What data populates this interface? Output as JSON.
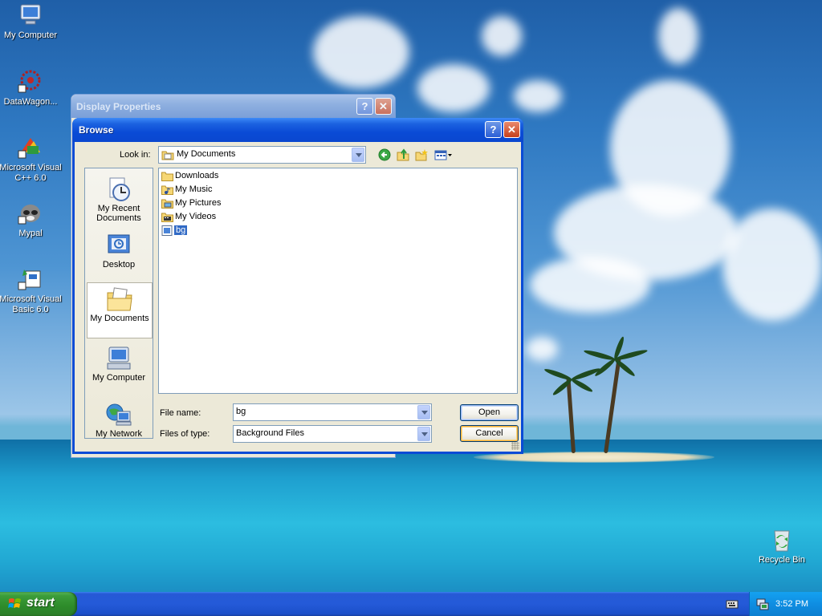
{
  "desktop": {
    "icons": [
      {
        "label": "My Computer",
        "icon": "my-computer-icon"
      },
      {
        "label": "DataWagon...",
        "icon": "datawagon-icon"
      },
      {
        "label": "Microsoft Visual C++ 6.0",
        "icon": "visual-cpp-icon"
      },
      {
        "label": "Mypal",
        "icon": "mypal-icon"
      },
      {
        "label": "Microsoft Visual Basic 6.0",
        "icon": "visual-basic-icon"
      }
    ],
    "recycle_bin": {
      "label": "Recycle Bin",
      "icon": "recycle-bin-icon"
    }
  },
  "display_properties": {
    "title": "Display Properties",
    "help_label": "?",
    "close_label": "✕"
  },
  "browse": {
    "title": "Browse",
    "help_label": "?",
    "close_label": "✕",
    "look_in_label": "Look in:",
    "look_in_value": "My Documents",
    "toolbar_icons": [
      "back-icon",
      "up-folder-icon",
      "new-folder-icon",
      "views-menu-icon"
    ],
    "places": [
      {
        "label": "My Recent Documents",
        "icon": "recent-documents-icon",
        "selected": false
      },
      {
        "label": "Desktop",
        "icon": "desktop-icon",
        "selected": false
      },
      {
        "label": "My Documents",
        "icon": "my-documents-icon",
        "selected": true
      },
      {
        "label": "My Computer",
        "icon": "my-computer-icon",
        "selected": false
      },
      {
        "label": "My Network",
        "icon": "my-network-icon",
        "selected": false
      }
    ],
    "files": [
      {
        "name": "Downloads",
        "icon": "folder-icon",
        "selected": false
      },
      {
        "name": "My Music",
        "icon": "music-folder-icon",
        "selected": false
      },
      {
        "name": "My Pictures",
        "icon": "pictures-folder-icon",
        "selected": false
      },
      {
        "name": "My Videos",
        "icon": "videos-folder-icon",
        "selected": false
      },
      {
        "name": "bg",
        "icon": "bmp-file-icon",
        "selected": true
      }
    ],
    "file_name_label": "File name:",
    "file_name_value": "bg",
    "file_type_label": "Files of type:",
    "file_type_value": "Background Files",
    "open_label": "Open",
    "cancel_label": "Cancel"
  },
  "taskbar": {
    "start_label": "start",
    "clock": "3:52 PM",
    "tray_icons": [
      "keyboard-icon",
      "network-tray-icon"
    ]
  },
  "colors": {
    "title_active": "#0a4bd6",
    "selection": "#316ac5",
    "taskbar": "#245ad8",
    "start_button": "#3c9d3a"
  }
}
